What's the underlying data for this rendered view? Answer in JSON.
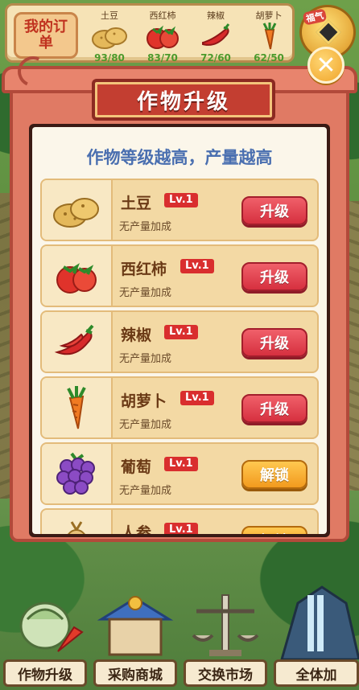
{
  "orders": {
    "button_label": "我的订单",
    "items": [
      {
        "name": "土豆",
        "progress": "93/80",
        "icon": "potato-icon"
      },
      {
        "name": "西红柿",
        "progress": "83/70",
        "icon": "tomato-icon"
      },
      {
        "name": "辣椒",
        "progress": "72/60",
        "icon": "chili-icon"
      },
      {
        "name": "胡萝卜",
        "progress": "62/50",
        "icon": "carrot-icon"
      }
    ],
    "coin_badge": "福气"
  },
  "modal": {
    "title": "作物升级",
    "subtitle": "作物等级越高，产量越高",
    "close_icon": "close-icon",
    "crops": [
      {
        "name": "土豆",
        "level": "Lv.1",
        "desc": "无产量加成",
        "action": "升级",
        "action_type": "upgrade",
        "icon": "potato-icon"
      },
      {
        "name": "西红柿",
        "level": "Lv.1",
        "desc": "无产量加成",
        "action": "升级",
        "action_type": "upgrade",
        "icon": "tomato-icon"
      },
      {
        "name": "辣椒",
        "level": "Lv.1",
        "desc": "无产量加成",
        "action": "升级",
        "action_type": "upgrade",
        "icon": "chili-icon"
      },
      {
        "name": "胡萝卜",
        "level": "Lv.1",
        "desc": "无产量加成",
        "action": "升级",
        "action_type": "upgrade",
        "icon": "carrot-icon"
      },
      {
        "name": "葡萄",
        "level": "Lv.1",
        "desc": "无产量加成",
        "action": "解锁",
        "action_type": "unlock",
        "icon": "grape-icon"
      },
      {
        "name": "人参",
        "level": "Lv.1",
        "desc": "",
        "action": "解锁",
        "action_type": "unlock",
        "icon": "ginseng-icon"
      }
    ]
  },
  "bottom_nav": [
    {
      "label": "作物升级",
      "icon": "cabbage-upgrade-icon"
    },
    {
      "label": "采购商城",
      "icon": "shop-icon"
    },
    {
      "label": "交换市场",
      "icon": "scale-icon"
    },
    {
      "label": "全体加",
      "icon": "waterfall-icon"
    }
  ]
}
